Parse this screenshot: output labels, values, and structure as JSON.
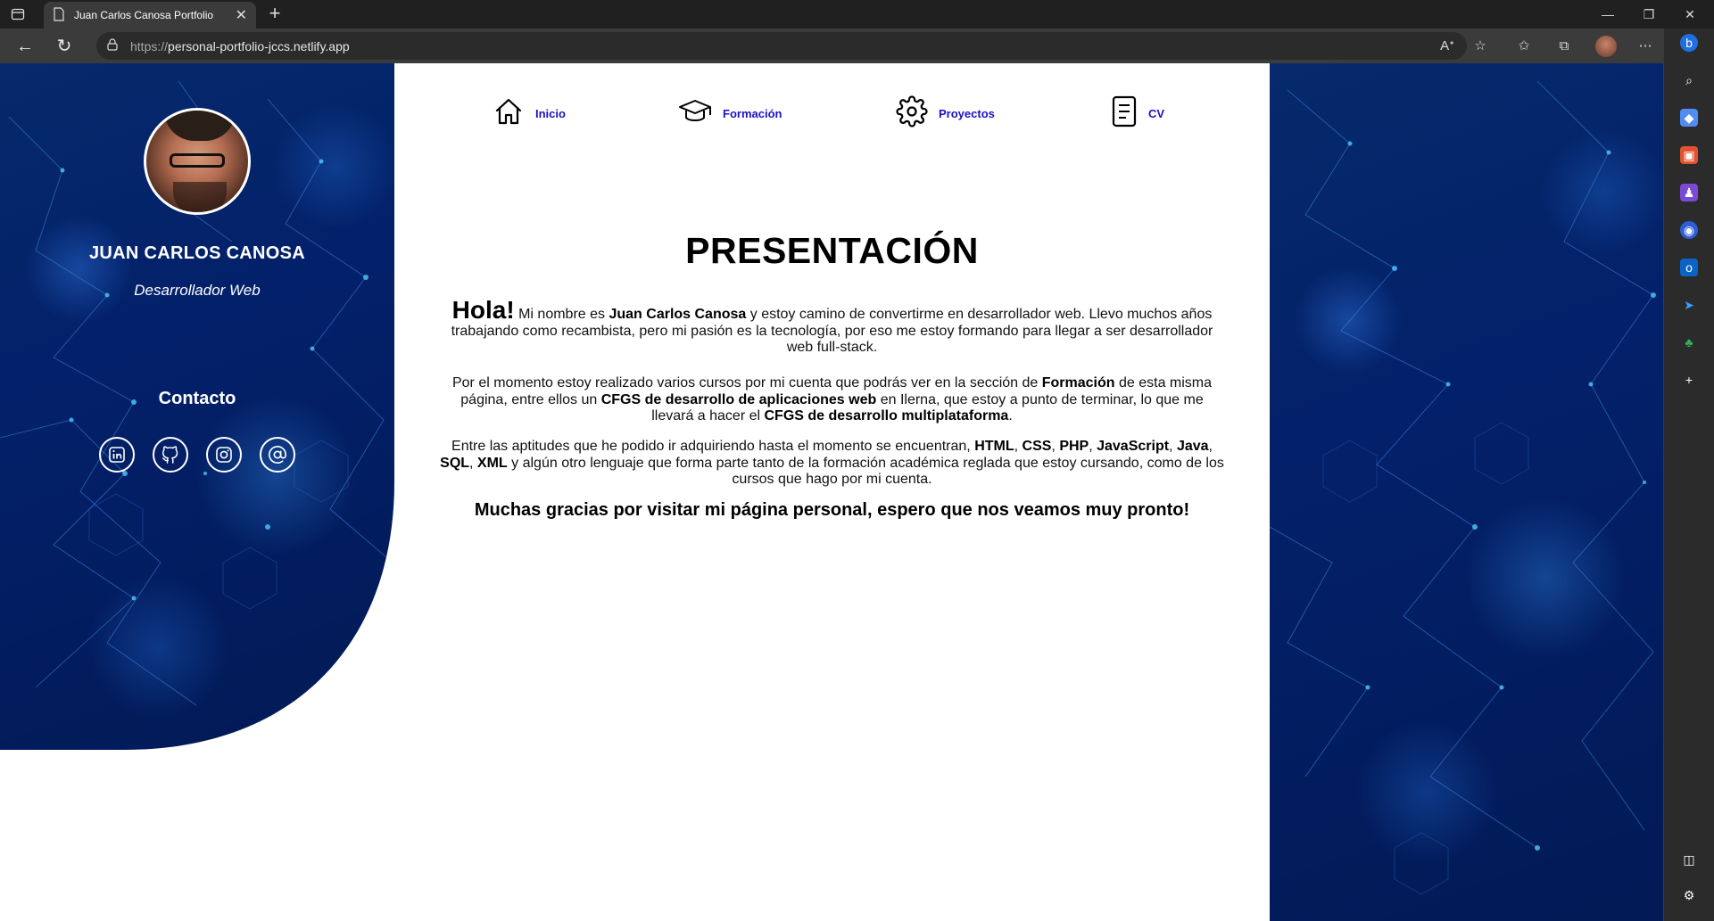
{
  "browser": {
    "tab_title": "Juan Carlos Canosa Portfolio",
    "url_protocol": "https://",
    "url_host": "personal-portfolio-jccs.netlify.app"
  },
  "sidebar": {
    "name": "JUAN CARLOS CANOSA",
    "role": "Desarrollador Web",
    "contact_title": "Contacto",
    "social": [
      "linkedin-icon",
      "github-icon",
      "instagram-icon",
      "email-icon"
    ]
  },
  "nav": {
    "items": [
      {
        "label": "Inicio",
        "icon": "home-icon"
      },
      {
        "label": "Formación",
        "icon": "graduation-cap-icon"
      },
      {
        "label": "Proyectos",
        "icon": "gear-icon"
      },
      {
        "label": "CV",
        "icon": "document-icon"
      }
    ]
  },
  "main": {
    "title": "PRESENTACIÓN",
    "p1": {
      "hola": "Hola!",
      "t1": " Mi nombre es ",
      "b1": "Juan Carlos Canosa",
      "t2": " y estoy camino de convertirme en desarrollador web. Llevo muchos años trabajando como recambista, pero mi pasión es la tecnología, por eso me estoy formando para llegar a ser desarrollador web full-stack."
    },
    "p2": {
      "t1": "Por el momento estoy realizado varios cursos por mi cuenta que podrás ver en la sección de ",
      "b1": "Formación",
      "t2": " de esta misma página, entre ellos un ",
      "b2": "CFGS de desarrollo de aplicaciones web",
      "t3": " en Ilerna, que estoy a punto de terminar, lo que me llevará a hacer el ",
      "b3": "CFGS de desarrollo multiplataforma",
      "t4": "."
    },
    "p3": {
      "t1": "Entre las aptitudes que he podido ir adquiriendo hasta el momento se encuentran, ",
      "b1": "HTML",
      "s1": ", ",
      "b2": "CSS",
      "s2": ", ",
      "b3": "PHP",
      "s3": ", ",
      "b4": "JavaScript",
      "s4": ", ",
      "b5": "Java",
      "s5": ", ",
      "b6": "SQL",
      "s6": ", ",
      "b7": "XML",
      "t2": " y algún otro lenguaje que forma parte tanto de la formación académica reglada que estoy cursando, como de los cursos que hago por mi cuenta."
    },
    "thanks": "Muchas gracias por visitar mi página personal, espero que nos veamos muy pronto!"
  }
}
